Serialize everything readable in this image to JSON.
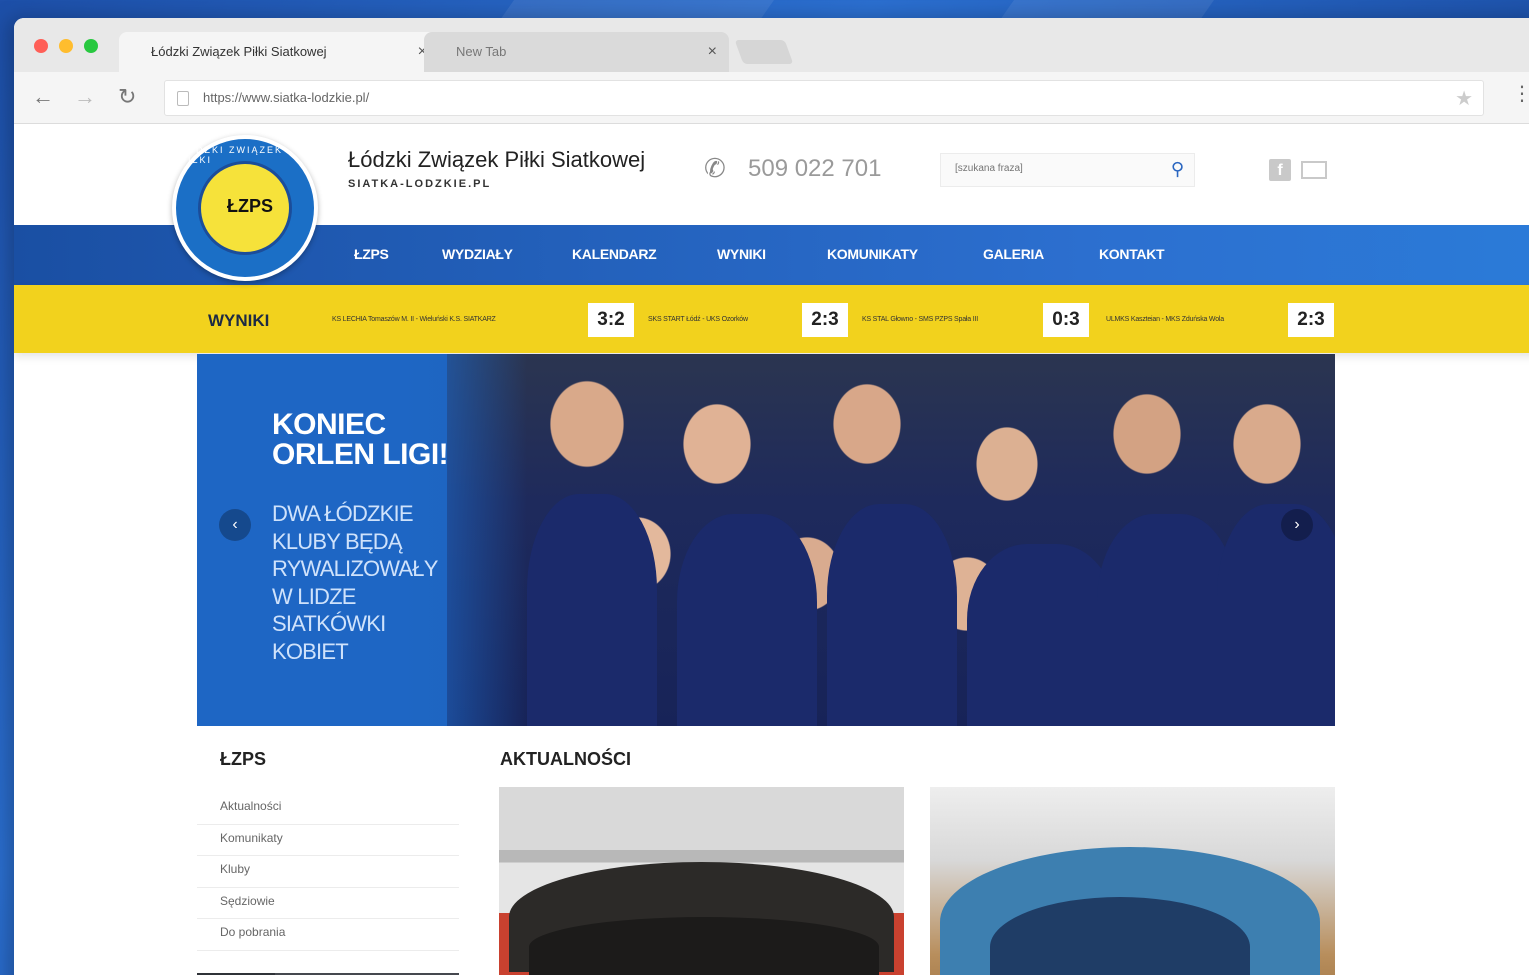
{
  "browser": {
    "tabs": [
      {
        "title": "Łódzki Związek Piłki Siatkowej",
        "active": true
      },
      {
        "title": "New Tab",
        "active": false
      }
    ],
    "url": "https://www.siatka-lodzkie.pl/",
    "close_glyph": "×"
  },
  "header": {
    "logo_text": "ŁZPS",
    "logo_ring_text": "ŁÓDZKI ZWIĄZEK PIŁKI",
    "title": "Łódzki Związek Piłki Siatkowej",
    "subtitle": "SIATKA-LODZKIE.PL",
    "phone": "509 022 701",
    "search_placeholder": "[szukana fraza]"
  },
  "nav": {
    "items": [
      "ŁZPS",
      "WYDZIAŁY",
      "KALENDARZ",
      "WYNIKI",
      "KOMUNIKATY",
      "GALERIA",
      "KONTAKT"
    ]
  },
  "results": {
    "title": "WYNIKI",
    "matches": [
      {
        "teams": "KS LECHIA Tomaszów M. II - Wieluński K.S. SIATKARZ",
        "score": "3:2"
      },
      {
        "teams": "SKS START Łódź - UKS Ozorków",
        "score": "2:3"
      },
      {
        "teams": "KS STAL Głowno - SMS PZPS Spała III",
        "score": "0:3"
      },
      {
        "teams": "ULMKS Kaszteian - MKS Zduńska Wola",
        "score": "2:3"
      }
    ]
  },
  "hero": {
    "title_line1": "KONIEC",
    "title_line2": "ORLEN LIGI!",
    "text_lines": [
      "DWA ŁÓDZKIE",
      "KLUBY BĘDĄ",
      "RYWALIZOWAŁY",
      "W LIDZE",
      "SIATKÓWKI",
      "KOBIET"
    ],
    "prev_glyph": "‹",
    "next_glyph": "›"
  },
  "sidebar": {
    "title": "ŁZPS",
    "items": [
      "Aktualności",
      "Komunikaty",
      "Kluby",
      "Sędziowie",
      "Do pobrania"
    ]
  },
  "news": {
    "title": "AKTUALNOŚCI"
  },
  "colors": {
    "nav_blue": "#1a4fa3",
    "results_yellow": "#f2d21d",
    "hero_blue": "#1f64bf"
  },
  "icons": {
    "back": "arrow-left-icon",
    "forward": "arrow-right-icon",
    "reload": "reload-icon",
    "star": "star-icon",
    "menu": "kebab-menu-icon",
    "phone": "phone-icon",
    "search": "search-icon",
    "facebook": "facebook-icon",
    "mail": "mail-icon"
  }
}
